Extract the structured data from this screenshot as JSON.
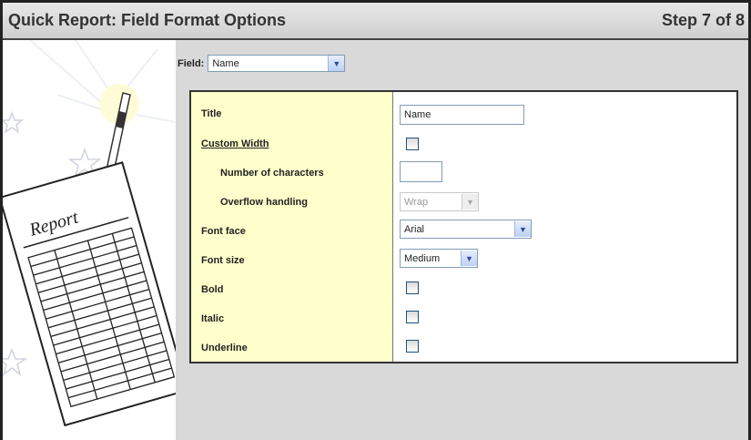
{
  "header": {
    "title": "Quick Report: Field Format Options",
    "step": "Step 7 of 8"
  },
  "sidebar": {
    "illustration_label": "Report"
  },
  "field_selector": {
    "label": "Field:",
    "value": "Name"
  },
  "form": {
    "rows": [
      {
        "label": "Title",
        "value": "Name"
      },
      {
        "label": "Custom Width",
        "checked": false
      },
      {
        "label": "Number of characters",
        "value": ""
      },
      {
        "label": "Overflow handling",
        "value": "Wrap",
        "disabled": true
      },
      {
        "label": "Font face",
        "value": "Arial"
      },
      {
        "label": "Font size",
        "value": "Medium"
      },
      {
        "label": "Bold",
        "checked": false
      },
      {
        "label": "Italic",
        "checked": false
      },
      {
        "label": "Underline",
        "checked": false
      }
    ]
  },
  "colors": {
    "label_column_bg": "#ffffcc",
    "background": "#d9d9d9"
  }
}
